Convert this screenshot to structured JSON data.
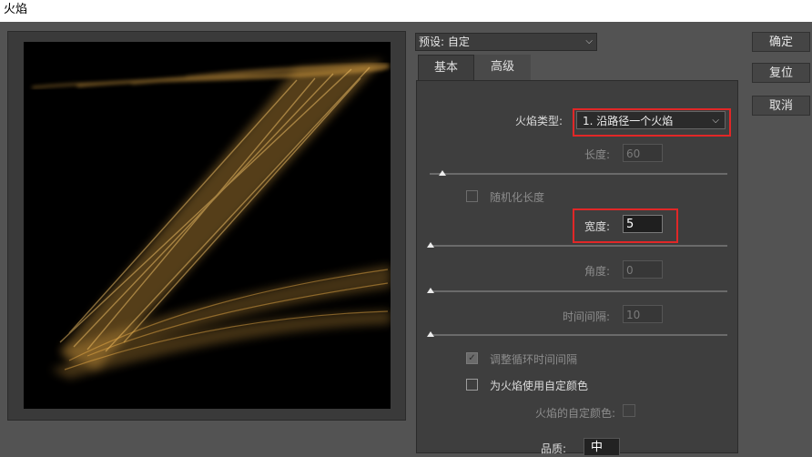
{
  "window": {
    "title": "火焰"
  },
  "preset": {
    "label": "预设: 自定"
  },
  "tabs": [
    {
      "label": "基本"
    },
    {
      "label": "高级"
    }
  ],
  "basic": {
    "flame_type": {
      "label": "火焰类型:",
      "value": "1. 沿路径一个火焰"
    },
    "length": {
      "label": "长度:",
      "value": "60",
      "slider_fraction": 0.04
    },
    "randomize_length": {
      "label": "随机化长度",
      "checked": false
    },
    "width": {
      "label": "宽度:",
      "value": "5",
      "slider_fraction": 0.0
    },
    "angle": {
      "label": "角度:",
      "value": "0",
      "slider_fraction": 0.0
    },
    "interval": {
      "label": "时间间隔:",
      "value": "10",
      "slider_fraction": 0.0
    },
    "adjust_loop": {
      "label": "调整循环时间间隔",
      "checked": true
    },
    "use_custom_color": {
      "label": "为火焰使用自定颜色",
      "checked": false
    },
    "custom_color_label": "火焰的自定颜色:",
    "quality": {
      "label": "品质:",
      "value": "中"
    }
  },
  "buttons": {
    "ok": "确定",
    "reset": "复位",
    "cancel": "取消"
  },
  "colors": {
    "flame": "#f2b24a",
    "highlight": "#e12727"
  }
}
